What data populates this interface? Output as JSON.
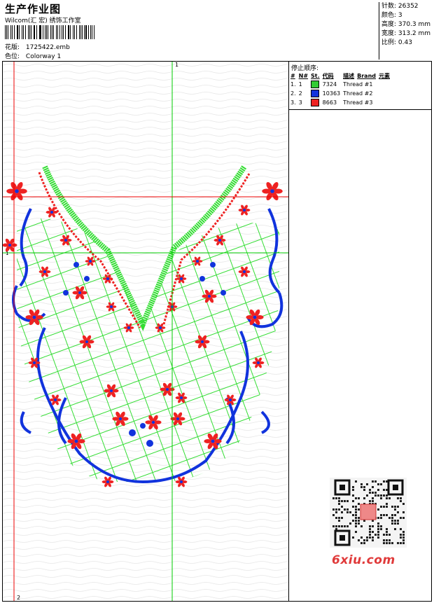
{
  "header": {
    "title": "生产作业图",
    "company": "Wilcom(汇 宏) 绣饰工作室",
    "pattern_label": "花版:",
    "pattern_value": "1725422.emb",
    "color_label": "色位:",
    "color_value": "Colorway 1"
  },
  "stats": {
    "stitches": "针数: 26352",
    "colors": "颜色: 3",
    "height": "高度: 370.3 mm",
    "width": "宽度: 313.2 mm",
    "scale": "比例: 0.43"
  },
  "panel": {
    "title": "停止顺序:",
    "columns": [
      "#",
      "N#",
      "St.",
      "代码",
      "描述",
      "Brand",
      "元素"
    ],
    "rows": [
      {
        "index": "1.",
        "n": "1",
        "color": "#33cc33",
        "code": "7324",
        "desc": "Thread #1"
      },
      {
        "index": "2.",
        "n": "2",
        "color": "#1133dd",
        "code": "10363",
        "desc": "Thread #2"
      },
      {
        "index": "3.",
        "n": "3",
        "color": "#ee2222",
        "code": "8663",
        "desc": "Thread #3"
      }
    ]
  },
  "guides": {
    "v_label": "1",
    "h_label": "2",
    "side_label": "1"
  },
  "watermark": {
    "brand": "6xiu.com"
  },
  "colors": {
    "green": "#33dd33",
    "blue": "#1133dd",
    "red": "#ee2222",
    "guide_red": "#ee0000",
    "guide_green": "#00cc00"
  }
}
